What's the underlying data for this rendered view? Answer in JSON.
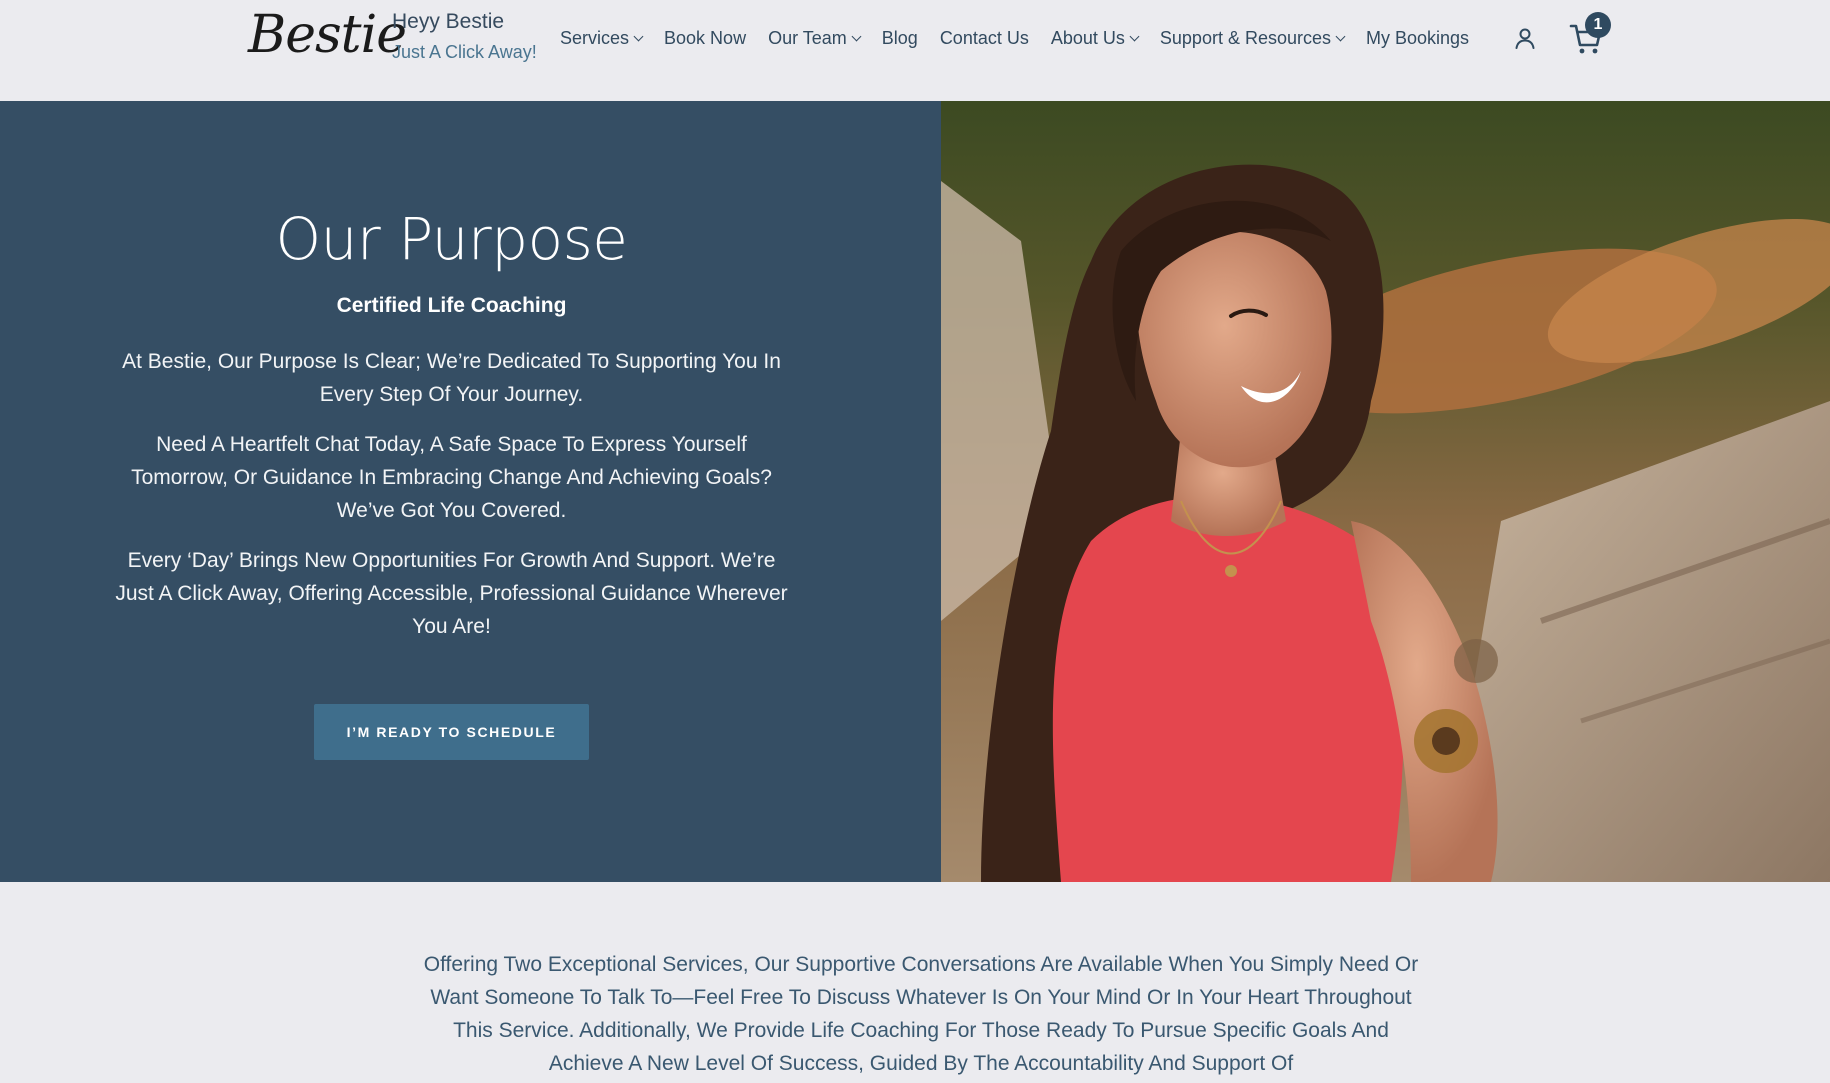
{
  "header": {
    "logo_text": "Bestie",
    "site_title": "Heyy Bestie",
    "site_tagline": "Just A Click Away!",
    "nav": [
      {
        "label": "Services",
        "has_dropdown": true
      },
      {
        "label": "Book Now",
        "has_dropdown": false
      },
      {
        "label": "Our Team",
        "has_dropdown": true
      },
      {
        "label": "Blog",
        "has_dropdown": false
      },
      {
        "label": "Contact Us",
        "has_dropdown": false
      },
      {
        "label": "About Us",
        "has_dropdown": true
      },
      {
        "label": "Support & Resources",
        "has_dropdown": true
      },
      {
        "label": "My Bookings",
        "has_dropdown": false
      }
    ],
    "account_icon": "user-icon",
    "cart_icon": "shopping-cart-icon",
    "cart_count": "1"
  },
  "hero": {
    "heading": "Our Purpose",
    "subheading": "Certified Life Coaching",
    "paragraphs": [
      "At Bestie, Our Purpose Is Clear; We’re Dedicated To Supporting You In Every Step Of Your Journey.",
      "Need A Heartfelt Chat Today, A Safe Space To Express Yourself Tomorrow, Or Guidance In Embracing Change And Achieving Goals? We’ve Got You Covered.",
      "Every ‘Day’ Brings New Opportunities For Growth And Support. We’re Just A Click Away, Offering Accessible, Professional Guidance Wherever You Are!"
    ],
    "cta_label": "I’M READY TO SCHEDULE"
  },
  "intro": {
    "text": "Offering Two Exceptional Services, Our Supportive Conversations Are Available When You Simply Need Or Want Someone To Talk To—Feel Free To Discuss Whatever Is On Your Mind Or In Your Heart Throughout This Service.  Additionally, We Provide Life Coaching For Those Ready To Pursue Specific Goals And Achieve A New Level Of Success, Guided By The Accountability And Support Of"
  },
  "colors": {
    "background": "#ebebef",
    "hero_panel": "#354e64",
    "button": "#3f6e8c",
    "text_primary": "#2f4a60",
    "accent_tagline": "#4a7590"
  }
}
